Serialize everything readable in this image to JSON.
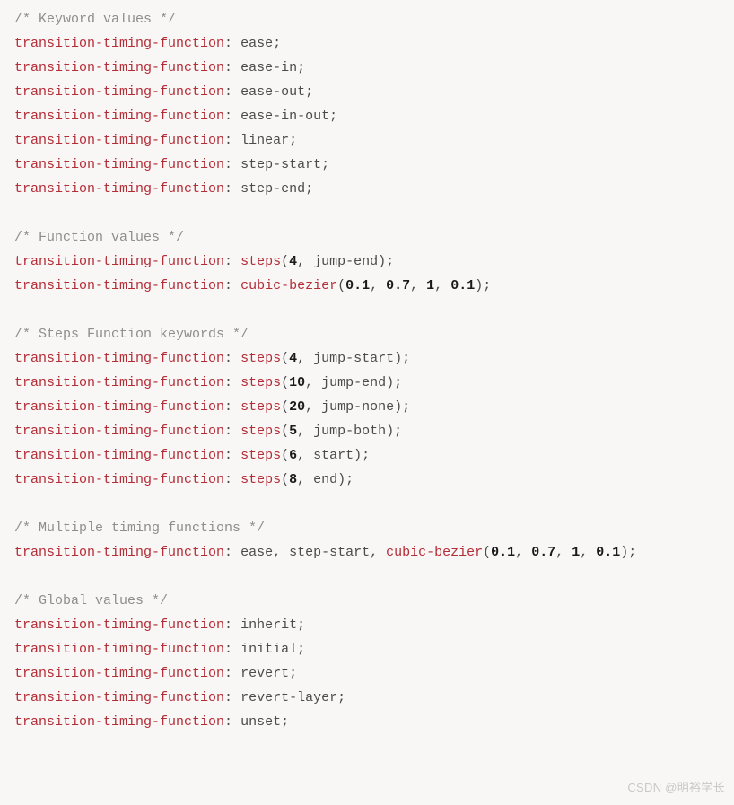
{
  "property": "transition-timing-function",
  "sections": {
    "keyword": {
      "comment": "/* Keyword values */",
      "lines": [
        [
          {
            "t": "prop"
          },
          {
            "t": "p",
            "v": ": "
          },
          {
            "t": "plain",
            "v": "ease"
          },
          {
            "t": "p",
            "v": ";"
          }
        ],
        [
          {
            "t": "prop"
          },
          {
            "t": "p",
            "v": ": "
          },
          {
            "t": "plain",
            "v": "ease-in"
          },
          {
            "t": "p",
            "v": ";"
          }
        ],
        [
          {
            "t": "prop"
          },
          {
            "t": "p",
            "v": ": "
          },
          {
            "t": "plain",
            "v": "ease-out"
          },
          {
            "t": "p",
            "v": ";"
          }
        ],
        [
          {
            "t": "prop"
          },
          {
            "t": "p",
            "v": ": "
          },
          {
            "t": "plain",
            "v": "ease-in-out"
          },
          {
            "t": "p",
            "v": ";"
          }
        ],
        [
          {
            "t": "prop"
          },
          {
            "t": "p",
            "v": ": "
          },
          {
            "t": "plain",
            "v": "linear"
          },
          {
            "t": "p",
            "v": ";"
          }
        ],
        [
          {
            "t": "prop"
          },
          {
            "t": "p",
            "v": ": "
          },
          {
            "t": "plain",
            "v": "step-start"
          },
          {
            "t": "p",
            "v": ";"
          }
        ],
        [
          {
            "t": "prop"
          },
          {
            "t": "p",
            "v": ": "
          },
          {
            "t": "plain",
            "v": "step-end"
          },
          {
            "t": "p",
            "v": ";"
          }
        ]
      ]
    },
    "function": {
      "comment": "/* Function values */",
      "lines": [
        [
          {
            "t": "prop"
          },
          {
            "t": "p",
            "v": ": "
          },
          {
            "t": "func",
            "v": "steps"
          },
          {
            "t": "p",
            "v": "("
          },
          {
            "t": "num",
            "v": "4"
          },
          {
            "t": "p",
            "v": ", "
          },
          {
            "t": "plain",
            "v": "jump-end"
          },
          {
            "t": "p",
            "v": ");"
          }
        ],
        [
          {
            "t": "prop"
          },
          {
            "t": "p",
            "v": ": "
          },
          {
            "t": "func",
            "v": "cubic-bezier"
          },
          {
            "t": "p",
            "v": "("
          },
          {
            "t": "num",
            "v": "0.1"
          },
          {
            "t": "p",
            "v": ", "
          },
          {
            "t": "num",
            "v": "0.7"
          },
          {
            "t": "p",
            "v": ", "
          },
          {
            "t": "num",
            "v": "1"
          },
          {
            "t": "p",
            "v": ", "
          },
          {
            "t": "num",
            "v": "0.1"
          },
          {
            "t": "p",
            "v": ");"
          }
        ]
      ]
    },
    "steps": {
      "comment": "/* Steps Function keywords */",
      "lines": [
        [
          {
            "t": "prop"
          },
          {
            "t": "p",
            "v": ": "
          },
          {
            "t": "func",
            "v": "steps"
          },
          {
            "t": "p",
            "v": "("
          },
          {
            "t": "num",
            "v": "4"
          },
          {
            "t": "p",
            "v": ", "
          },
          {
            "t": "plain",
            "v": "jump-start"
          },
          {
            "t": "p",
            "v": ");"
          }
        ],
        [
          {
            "t": "prop"
          },
          {
            "t": "p",
            "v": ": "
          },
          {
            "t": "func",
            "v": "steps"
          },
          {
            "t": "p",
            "v": "("
          },
          {
            "t": "num",
            "v": "10"
          },
          {
            "t": "p",
            "v": ", "
          },
          {
            "t": "plain",
            "v": "jump-end"
          },
          {
            "t": "p",
            "v": ");"
          }
        ],
        [
          {
            "t": "prop"
          },
          {
            "t": "p",
            "v": ": "
          },
          {
            "t": "func",
            "v": "steps"
          },
          {
            "t": "p",
            "v": "("
          },
          {
            "t": "num",
            "v": "20"
          },
          {
            "t": "p",
            "v": ", "
          },
          {
            "t": "plain",
            "v": "jump-none"
          },
          {
            "t": "p",
            "v": ");"
          }
        ],
        [
          {
            "t": "prop"
          },
          {
            "t": "p",
            "v": ": "
          },
          {
            "t": "func",
            "v": "steps"
          },
          {
            "t": "p",
            "v": "("
          },
          {
            "t": "num",
            "v": "5"
          },
          {
            "t": "p",
            "v": ", "
          },
          {
            "t": "plain",
            "v": "jump-both"
          },
          {
            "t": "p",
            "v": ");"
          }
        ],
        [
          {
            "t": "prop"
          },
          {
            "t": "p",
            "v": ": "
          },
          {
            "t": "func",
            "v": "steps"
          },
          {
            "t": "p",
            "v": "("
          },
          {
            "t": "num",
            "v": "6"
          },
          {
            "t": "p",
            "v": ", "
          },
          {
            "t": "plain",
            "v": "start"
          },
          {
            "t": "p",
            "v": ");"
          }
        ],
        [
          {
            "t": "prop"
          },
          {
            "t": "p",
            "v": ": "
          },
          {
            "t": "func",
            "v": "steps"
          },
          {
            "t": "p",
            "v": "("
          },
          {
            "t": "num",
            "v": "8"
          },
          {
            "t": "p",
            "v": ", "
          },
          {
            "t": "plain",
            "v": "end"
          },
          {
            "t": "p",
            "v": ");"
          }
        ]
      ]
    },
    "multiple": {
      "comment": "/* Multiple timing functions */",
      "lines": [
        [
          {
            "t": "prop"
          },
          {
            "t": "p",
            "v": ": "
          },
          {
            "t": "plain",
            "v": "ease"
          },
          {
            "t": "p",
            "v": ", "
          },
          {
            "t": "plain",
            "v": "step-start"
          },
          {
            "t": "p",
            "v": ", "
          },
          {
            "t": "func",
            "v": "cubic-bezier"
          },
          {
            "t": "p",
            "v": "("
          },
          {
            "t": "num",
            "v": "0.1"
          },
          {
            "t": "p",
            "v": ", "
          },
          {
            "t": "num",
            "v": "0.7"
          },
          {
            "t": "p",
            "v": ", "
          },
          {
            "t": "num",
            "v": "1"
          },
          {
            "t": "p",
            "v": ", "
          },
          {
            "t": "num",
            "v": "0.1"
          },
          {
            "t": "p",
            "v": ");"
          }
        ]
      ]
    },
    "global": {
      "comment": "/* Global values */",
      "lines": [
        [
          {
            "t": "prop"
          },
          {
            "t": "p",
            "v": ": "
          },
          {
            "t": "plain",
            "v": "inherit"
          },
          {
            "t": "p",
            "v": ";"
          }
        ],
        [
          {
            "t": "prop"
          },
          {
            "t": "p",
            "v": ": "
          },
          {
            "t": "plain",
            "v": "initial"
          },
          {
            "t": "p",
            "v": ";"
          }
        ],
        [
          {
            "t": "prop"
          },
          {
            "t": "p",
            "v": ": "
          },
          {
            "t": "plain",
            "v": "revert"
          },
          {
            "t": "p",
            "v": ";"
          }
        ],
        [
          {
            "t": "prop"
          },
          {
            "t": "p",
            "v": ": "
          },
          {
            "t": "plain",
            "v": "revert-layer"
          },
          {
            "t": "p",
            "v": ";"
          }
        ],
        [
          {
            "t": "prop"
          },
          {
            "t": "p",
            "v": ": "
          },
          {
            "t": "plain",
            "v": "unset"
          },
          {
            "t": "p",
            "v": ";"
          }
        ]
      ]
    }
  },
  "section_order": [
    "keyword",
    "function",
    "steps",
    "multiple",
    "global"
  ],
  "watermark": "CSDN @明裕学长"
}
